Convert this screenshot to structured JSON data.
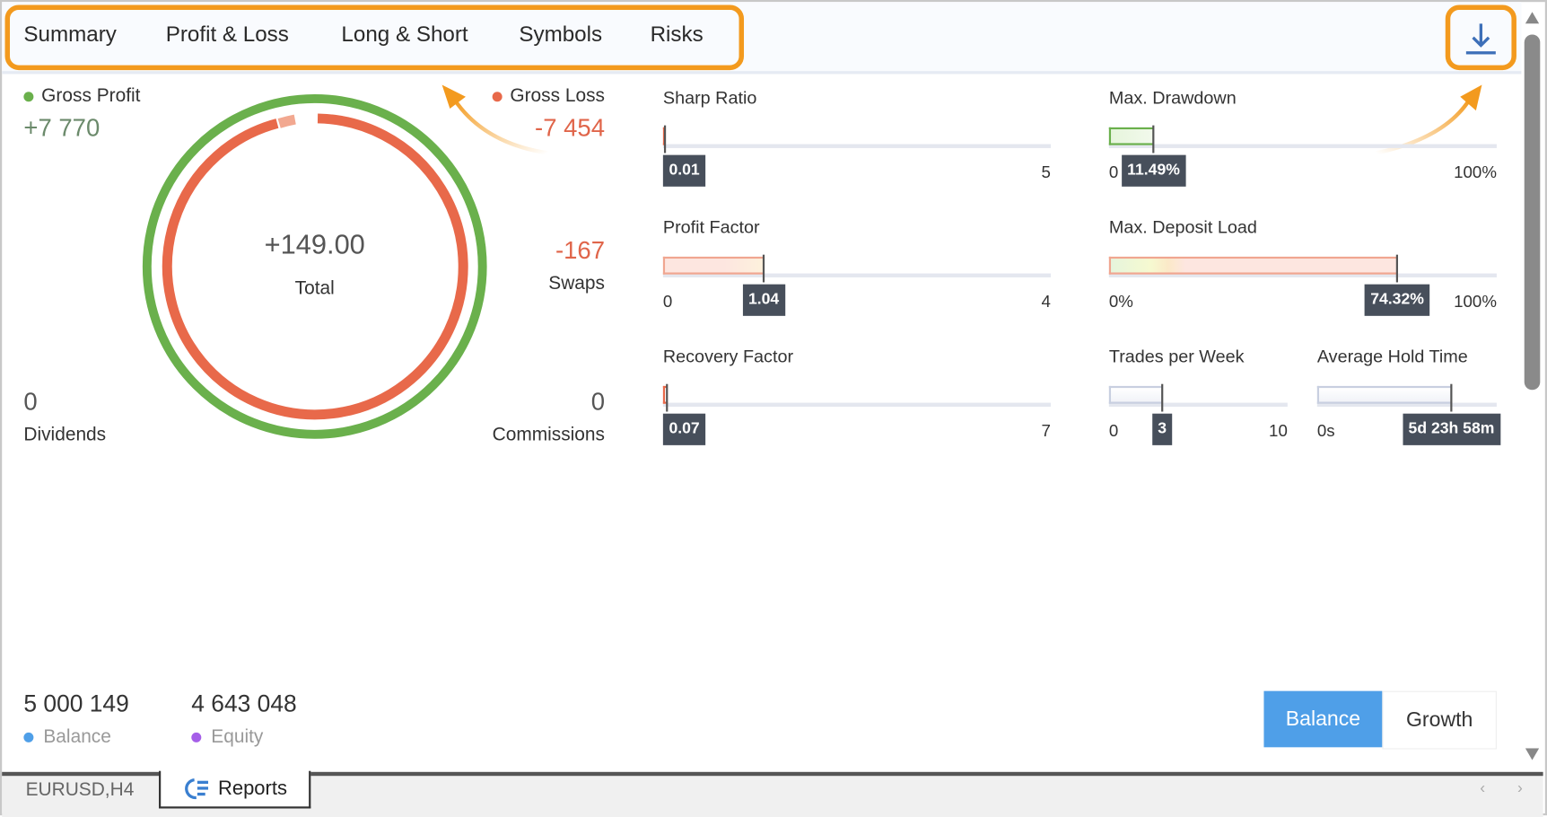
{
  "tabs": [
    {
      "label": "Summary"
    },
    {
      "label": "Profit & Loss"
    },
    {
      "label": "Long & Short"
    },
    {
      "label": "Symbols"
    },
    {
      "label": "Risks"
    }
  ],
  "download_icon": "download-icon",
  "summary": {
    "gross_profit": {
      "label": "Gross Profit",
      "value": "+7 770"
    },
    "gross_loss": {
      "label": "Gross Loss",
      "value": "-7 454"
    },
    "total": {
      "label": "Total",
      "value": "+149.00"
    },
    "swaps": {
      "label": "Swaps",
      "value": "-167"
    },
    "dividends": {
      "label": "Dividends",
      "value": "0"
    },
    "commissions": {
      "label": "Commissions",
      "value": "0"
    }
  },
  "colors": {
    "profit": "#6ab04c",
    "loss": "#e8694a",
    "accent": "#f39a1e",
    "balance": "#4f9fe8",
    "equity": "#a55ee8"
  },
  "metrics": {
    "sharp_ratio": {
      "title": "Sharp Ratio",
      "value": "0.01",
      "min": "0",
      "max": "5",
      "level": 0.01,
      "scale": 5
    },
    "max_drawdown": {
      "title": "Max. Drawdown",
      "value": "11.49%",
      "min": "0",
      "max": "100%",
      "level": 11.49,
      "scale": 100
    },
    "profit_factor": {
      "title": "Profit Factor",
      "value": "1.04",
      "min": "0",
      "max": "4",
      "level": 1.04,
      "scale": 4
    },
    "max_deposit_load": {
      "title": "Max. Deposit Load",
      "value": "74.32%",
      "min": "0%",
      "max": "100%",
      "level": 74.32,
      "scale": 100
    },
    "recovery_factor": {
      "title": "Recovery Factor",
      "value": "0.07",
      "min": "0",
      "max": "7",
      "level": 0.07,
      "scale": 7
    },
    "trades_per_week": {
      "title": "Trades per Week",
      "value": "3",
      "min": "0",
      "max": "10",
      "level": 3,
      "scale": 10
    },
    "avg_hold_time": {
      "title": "Average Hold Time",
      "value": "5d 23h 58m",
      "min": "0s",
      "max": "8d",
      "level": 8638,
      "scale": 11520
    }
  },
  "footer": {
    "balance": {
      "value": "5 000 149",
      "label": "Balance"
    },
    "equity": {
      "value": "4 643 048",
      "label": "Equity"
    },
    "toggle": {
      "balance": "Balance",
      "growth": "Growth",
      "selected": "Balance"
    }
  },
  "bottom_tabs": [
    {
      "label": "EURUSD,H4"
    },
    {
      "label": "Reports"
    }
  ]
}
